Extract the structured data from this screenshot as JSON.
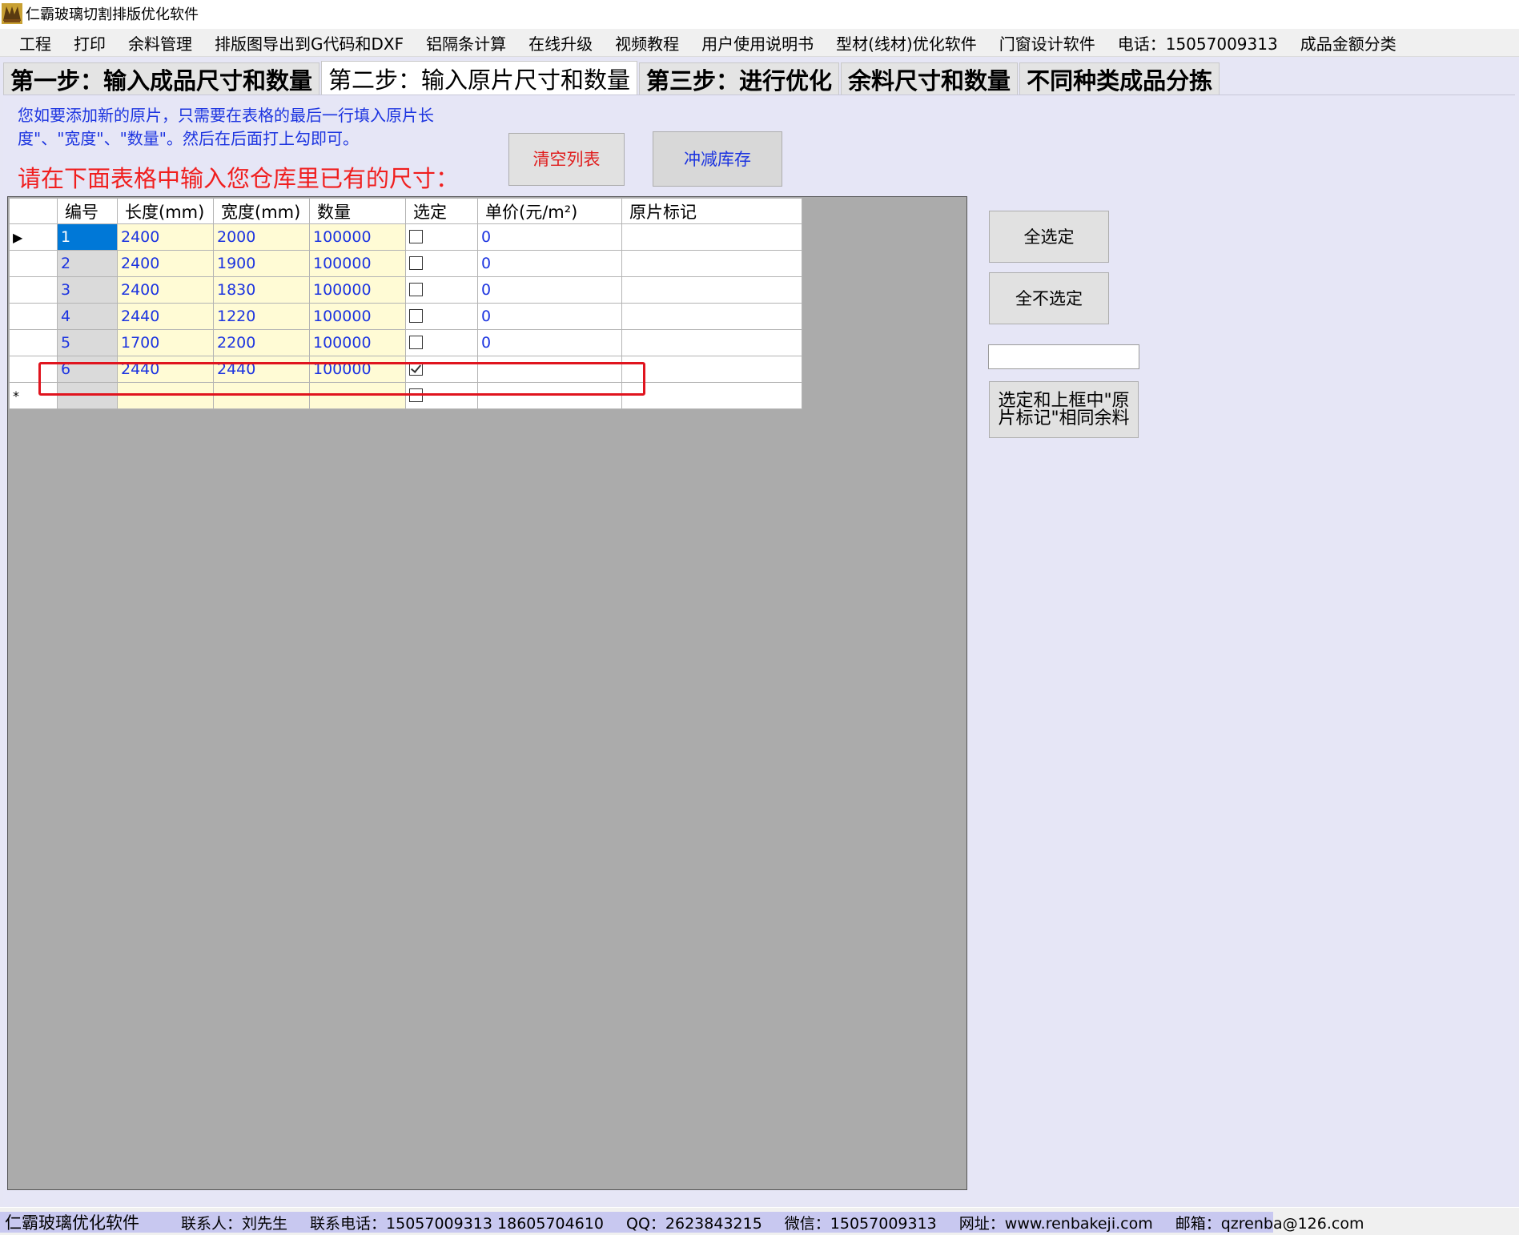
{
  "window": {
    "title": "仁霸玻璃切割排版优化软件"
  },
  "menu": [
    "工程",
    "打印",
    "余料管理",
    "排版图导出到G代码和DXF",
    "铝隔条计算",
    "在线升级",
    "视频教程",
    "用户使用说明书",
    "型材(线材)优化软件",
    "门窗设计软件",
    "电话：15057009313",
    "成品金额分类"
  ],
  "tabs": [
    {
      "label": "第一步：输入成品尺寸和数量",
      "active": false
    },
    {
      "label": "第二步：输入原片尺寸和数量",
      "active": true
    },
    {
      "label": "第三步：进行优化",
      "active": false
    },
    {
      "label": "余料尺寸和数量",
      "active": false
    },
    {
      "label": "不同种类成品分拣",
      "active": false
    }
  ],
  "hint": {
    "blue": "您如要添加新的原片，只需要在表格的最后一行填入原片长度\"、\"宽度\"、\"数量\"。然后在后面打上勾即可。",
    "red": "请在下面表格中输入您仓库里已有的尺寸："
  },
  "buttons": {
    "clear": "清空列表",
    "deduct": "冲减库存",
    "select_all": "全选定",
    "unselect_all": "全不选定",
    "select_match": "选定和上框中\"原片标记\"相同余料"
  },
  "mark_filter": {
    "value": ""
  },
  "grid": {
    "columns": [
      "编号",
      "长度(mm)",
      "宽度(mm)",
      "数量",
      "选定",
      "单价(元/m²)",
      "原片标记"
    ],
    "rows": [
      {
        "indicator": "▶",
        "id": "1",
        "length": "2400",
        "width": "2000",
        "qty": "100000",
        "checked": false,
        "price": "0",
        "mark": "",
        "selected": true
      },
      {
        "indicator": "",
        "id": "2",
        "length": "2400",
        "width": "1900",
        "qty": "100000",
        "checked": false,
        "price": "0",
        "mark": ""
      },
      {
        "indicator": "",
        "id": "3",
        "length": "2400",
        "width": "1830",
        "qty": "100000",
        "checked": false,
        "price": "0",
        "mark": ""
      },
      {
        "indicator": "",
        "id": "4",
        "length": "2440",
        "width": "1220",
        "qty": "100000",
        "checked": false,
        "price": "0",
        "mark": ""
      },
      {
        "indicator": "",
        "id": "5",
        "length": "1700",
        "width": "2200",
        "qty": "100000",
        "checked": false,
        "price": "0",
        "mark": ""
      },
      {
        "indicator": "",
        "id": "6",
        "length": "2440",
        "width": "2440",
        "qty": "100000",
        "checked": true,
        "price": "",
        "mark": ""
      },
      {
        "indicator": "*",
        "id": "",
        "length": "",
        "width": "",
        "qty": "",
        "checked": false,
        "price": "",
        "mark": ""
      }
    ]
  },
  "status": {
    "app": "仁霸玻璃优化软件",
    "contact": "联系人：刘先生",
    "phone": "联系电话：15057009313 18605704610",
    "qq": "QQ：2623843215",
    "wechat": "微信：15057009313",
    "site": "网址：www.renbakeji.com",
    "email": "邮箱：qzrenba@126.com"
  },
  "colors": {
    "accent_blue": "#1c34e0",
    "warn_red": "#f01e1e",
    "panel_bg": "#e6e6f5",
    "highlight_red": "#e0141e"
  }
}
